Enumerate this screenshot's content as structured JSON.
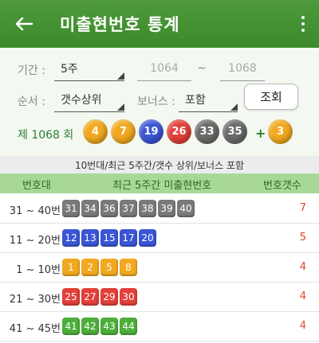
{
  "header": {
    "title": "미출현번호 통계"
  },
  "filters": {
    "period_label": "기간 :",
    "period_value": "5주",
    "from_value": "1064",
    "tilde": "~",
    "to_value": "1068",
    "order_label": "순서 :",
    "order_value": "갯수상위",
    "bonus_label": "보너스 :",
    "bonus_value": "포함",
    "search_label": "조회"
  },
  "draw": {
    "round_label": "제 1068 회",
    "plus": "+",
    "numbers": [
      {
        "n": "4",
        "color": "#f2a91f"
      },
      {
        "n": "7",
        "color": "#f2a91f"
      },
      {
        "n": "19",
        "color": "#3a56d6"
      },
      {
        "n": "26",
        "color": "#e2403a"
      },
      {
        "n": "33",
        "color": "#6a6a6a"
      },
      {
        "n": "35",
        "color": "#6a6a6a"
      }
    ],
    "bonus": {
      "n": "3",
      "color": "#f2a91f"
    }
  },
  "subtitle": "10번대/최근 5주간/갯수 상위/보너스 포함",
  "table": {
    "headers": [
      "번호대",
      "최근 5주간 미출현번호",
      "번호갯수"
    ],
    "rows": [
      {
        "range": "31 ~ 40번",
        "color": "#7a7a7a",
        "numbers": [
          "31",
          "34",
          "36",
          "37",
          "38",
          "39",
          "40"
        ],
        "count": "7"
      },
      {
        "range": "11 ~ 20번",
        "color": "#3a56d6",
        "numbers": [
          "12",
          "13",
          "15",
          "17",
          "20"
        ],
        "count": "5"
      },
      {
        "range": "1 ~ 10번",
        "color": "#f2a91f",
        "numbers": [
          "1",
          "2",
          "5",
          "8"
        ],
        "count": "4"
      },
      {
        "range": "21 ~ 30번",
        "color": "#e2403a",
        "numbers": [
          "25",
          "27",
          "29",
          "30"
        ],
        "count": "4"
      },
      {
        "range": "41 ~ 45번",
        "color": "#4caf3a",
        "numbers": [
          "41",
          "42",
          "43",
          "44"
        ],
        "count": "4"
      }
    ]
  }
}
